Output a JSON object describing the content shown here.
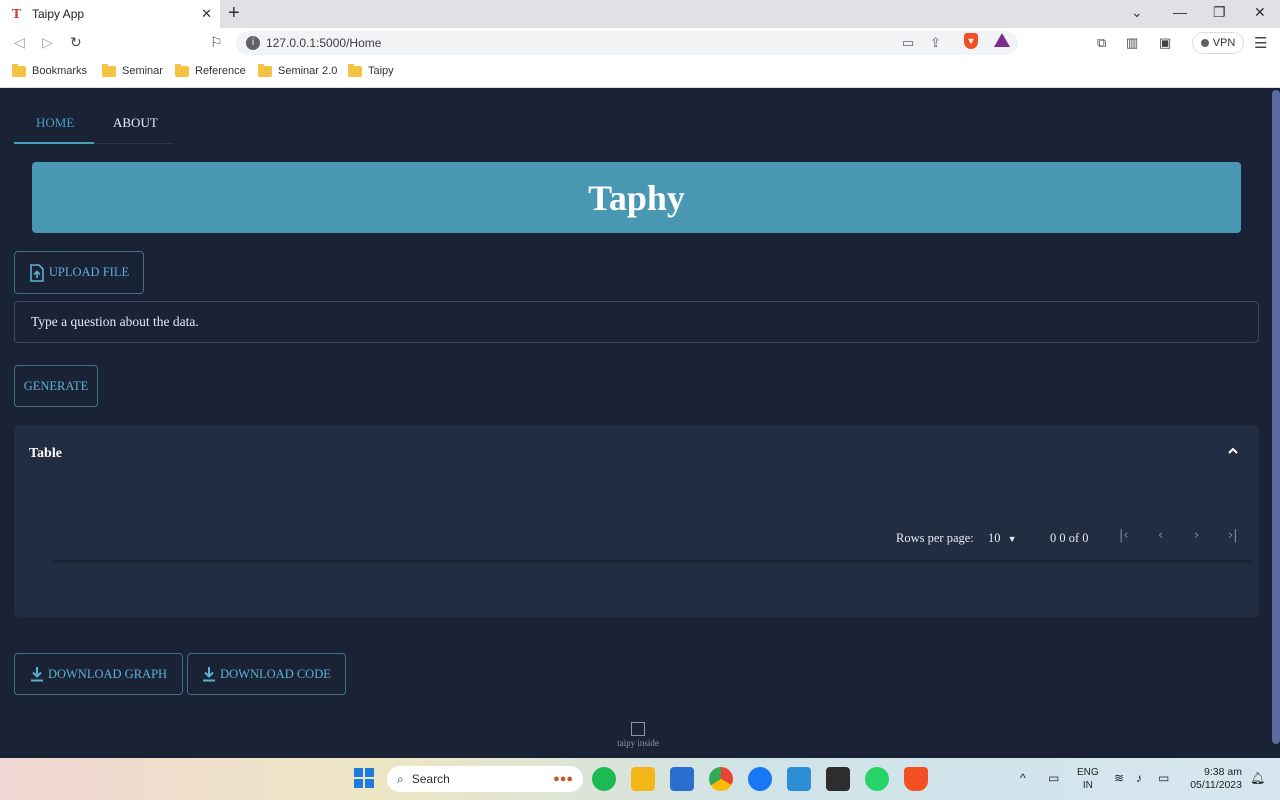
{
  "browser": {
    "tab_title": "Taipy App",
    "favicon_glyph": "T",
    "url": "127.0.0.1:5000/Home",
    "vpn_label": "VPN",
    "bookmarks": [
      "Bookmarks",
      "Seminar",
      "Reference",
      "Seminar 2.0",
      "Taipy"
    ]
  },
  "app": {
    "nav_tabs": [
      {
        "label": "HOME",
        "active": true
      },
      {
        "label": "ABOUT",
        "active": false
      }
    ],
    "banner_title": "Taphy",
    "upload_label": "UPLOAD FILE",
    "question_placeholder": "Type a question about the data.",
    "generate_label": "GENERATE",
    "table": {
      "title": "Table",
      "rows_per_page_label": "Rows per page:",
      "rows_per_page_value": "10",
      "range_text": "0  0 of 0"
    },
    "download_graph_label": "DOWNLOAD GRAPH",
    "download_code_label": "DOWNLOAD CODE",
    "footer_image_alt": "taipy inside"
  },
  "taskbar": {
    "search_label": "Search",
    "lang_line1": "ENG",
    "lang_line2": "IN",
    "time": "9:38 am",
    "date": "05/11/2023"
  },
  "colors": {
    "app_bg": "#1a2336",
    "panel_bg": "#222d42",
    "accent": "#4898b4",
    "accent_text": "#5fb0d0"
  }
}
